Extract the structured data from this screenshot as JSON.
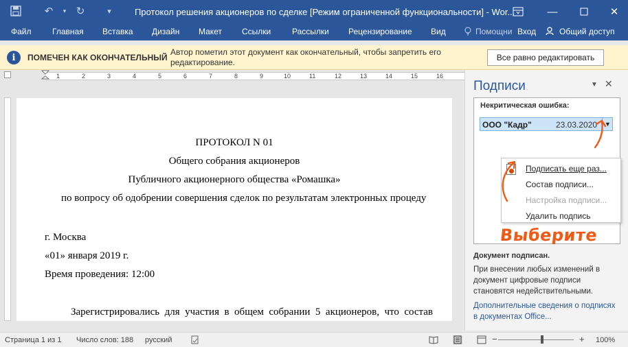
{
  "titlebar": {
    "title": "Протокол решения акционеров по сделке [Режим ограниченной функциональности] - Wor...",
    "bg_color": "#2b579a"
  },
  "menu": {
    "items": [
      "Файл",
      "Главная",
      "Вставка",
      "Дизайн",
      "Макет",
      "Ссылки",
      "Рассылки",
      "Рецензирование",
      "Вид"
    ],
    "help": "Помощни",
    "login": "Вход",
    "share": "Общий доступ"
  },
  "message_bar": {
    "title": "ПОМЕЧЕН КАК ОКОНЧАТЕЛЬНЫЙ",
    "text": "Автор пометил этот документ как окончательный, чтобы запретить его редактирование.",
    "button": "Все равно редактировать",
    "bg_color": "#fff4ce"
  },
  "ruler": {
    "numbers": [
      "1",
      "2",
      "3",
      "4",
      "5",
      "6",
      "7",
      "8",
      "9",
      "10",
      "11",
      "12",
      "13",
      "14",
      "15",
      "16"
    ]
  },
  "document": {
    "heading": "ПРОТОКОЛ N 01",
    "line2": "Общего собрания акционеров",
    "line3": "Публичного акционерного общества «Ромашка»",
    "line4": "по вопросу об одобрении совершения сделок по результатам электронных процеду",
    "city": "г. Москва",
    "date": "«01» января 2019 г.",
    "time": "Время проведения: 12:00",
    "para": "Зарегистрировались  для  участия  в  общем  собрании  5  акционеров,  что  состав"
  },
  "pane": {
    "title": "Подписи",
    "error_label": "Некритическая ошибка:",
    "signature": {
      "name": "ООО \"Кадр\"",
      "date": "23.03.2020"
    },
    "context_menu": [
      {
        "label": "Подписать еще раз...",
        "enabled": true
      },
      {
        "label": "Состав подписи...",
        "enabled": true
      },
      {
        "label": "Настройка подписи...",
        "enabled": false
      },
      {
        "label": "Удалить подпись",
        "enabled": true
      }
    ],
    "annotation": "Выберите",
    "annotation_color": "#ef5a16",
    "status_title": "Документ подписан.",
    "status_text": "При внесении любых изменений в документ цифровые подписи становятся недействительными.",
    "link": "Дополнительные сведения о подписях в документах Office..."
  },
  "statusbar": {
    "page": "Страница 1 из 1",
    "words": "Число слов: 188",
    "language": "русский",
    "zoom": "100%"
  }
}
